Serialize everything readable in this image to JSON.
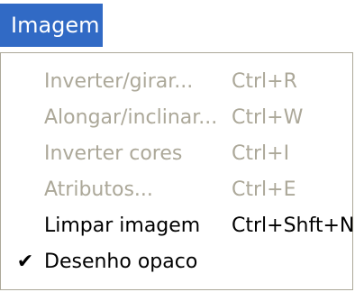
{
  "menu": {
    "title": "Imagem",
    "items": [
      {
        "label": "Inverter/girar...",
        "shortcut": "Ctrl+R",
        "enabled": false
      },
      {
        "label": "Alongar/inclinar...",
        "shortcut": "Ctrl+W",
        "enabled": false
      },
      {
        "label": "Inverter cores",
        "shortcut": "Ctrl+I",
        "enabled": false
      },
      {
        "label": "Atributos...",
        "shortcut": "Ctrl+E",
        "enabled": false
      },
      {
        "label": "Limpar imagem",
        "shortcut": "Ctrl+Shft+N",
        "enabled": true
      },
      {
        "label": "Desenho opaco",
        "checked": true,
        "check_icon": "checkmark-icon",
        "check_glyph": "✔",
        "enabled": true
      }
    ]
  },
  "colors": {
    "highlight": "#316ac5",
    "disabled_text": "#aca899",
    "enabled_text": "#000000",
    "border": "#aca899"
  }
}
